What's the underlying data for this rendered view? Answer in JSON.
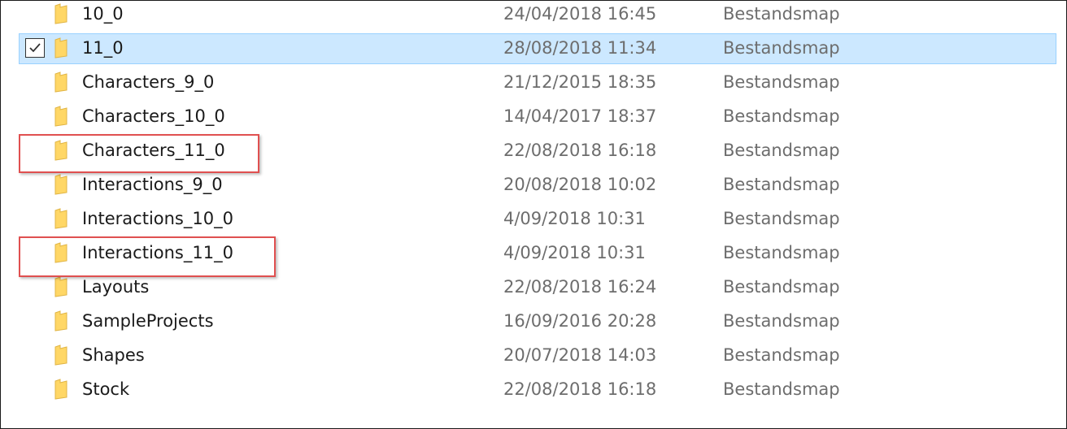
{
  "rows": [
    {
      "name": "10_0",
      "date": "24/04/2018 16:45",
      "type": "Bestandsmap",
      "selected": false
    },
    {
      "name": "11_0",
      "date": "28/08/2018 11:34",
      "type": "Bestandsmap",
      "selected": true
    },
    {
      "name": "Characters_9_0",
      "date": "21/12/2015 18:35",
      "type": "Bestandsmap",
      "selected": false
    },
    {
      "name": "Characters_10_0",
      "date": "14/04/2017 18:37",
      "type": "Bestandsmap",
      "selected": false
    },
    {
      "name": "Characters_11_0",
      "date": "22/08/2018 16:18",
      "type": "Bestandsmap",
      "selected": false
    },
    {
      "name": "Interactions_9_0",
      "date": "20/08/2018 10:02",
      "type": "Bestandsmap",
      "selected": false
    },
    {
      "name": "Interactions_10_0",
      "date": "4/09/2018 10:31",
      "type": "Bestandsmap",
      "selected": false
    },
    {
      "name": "Interactions_11_0",
      "date": "4/09/2018 10:31",
      "type": "Bestandsmap",
      "selected": false
    },
    {
      "name": "Layouts",
      "date": "22/08/2018 16:24",
      "type": "Bestandsmap",
      "selected": false
    },
    {
      "name": "SampleProjects",
      "date": "16/09/2016 20:28",
      "type": "Bestandsmap",
      "selected": false
    },
    {
      "name": "Shapes",
      "date": "20/07/2018 14:03",
      "type": "Bestandsmap",
      "selected": false
    },
    {
      "name": "Stock",
      "date": "22/08/2018 16:18",
      "type": "Bestandsmap",
      "selected": false
    }
  ],
  "icon": "folder-icon",
  "colors": {
    "selection_bg": "#cce8ff",
    "selection_border": "#99d1ff",
    "highlight_box": "#e05050",
    "folder": "#ffd766"
  }
}
